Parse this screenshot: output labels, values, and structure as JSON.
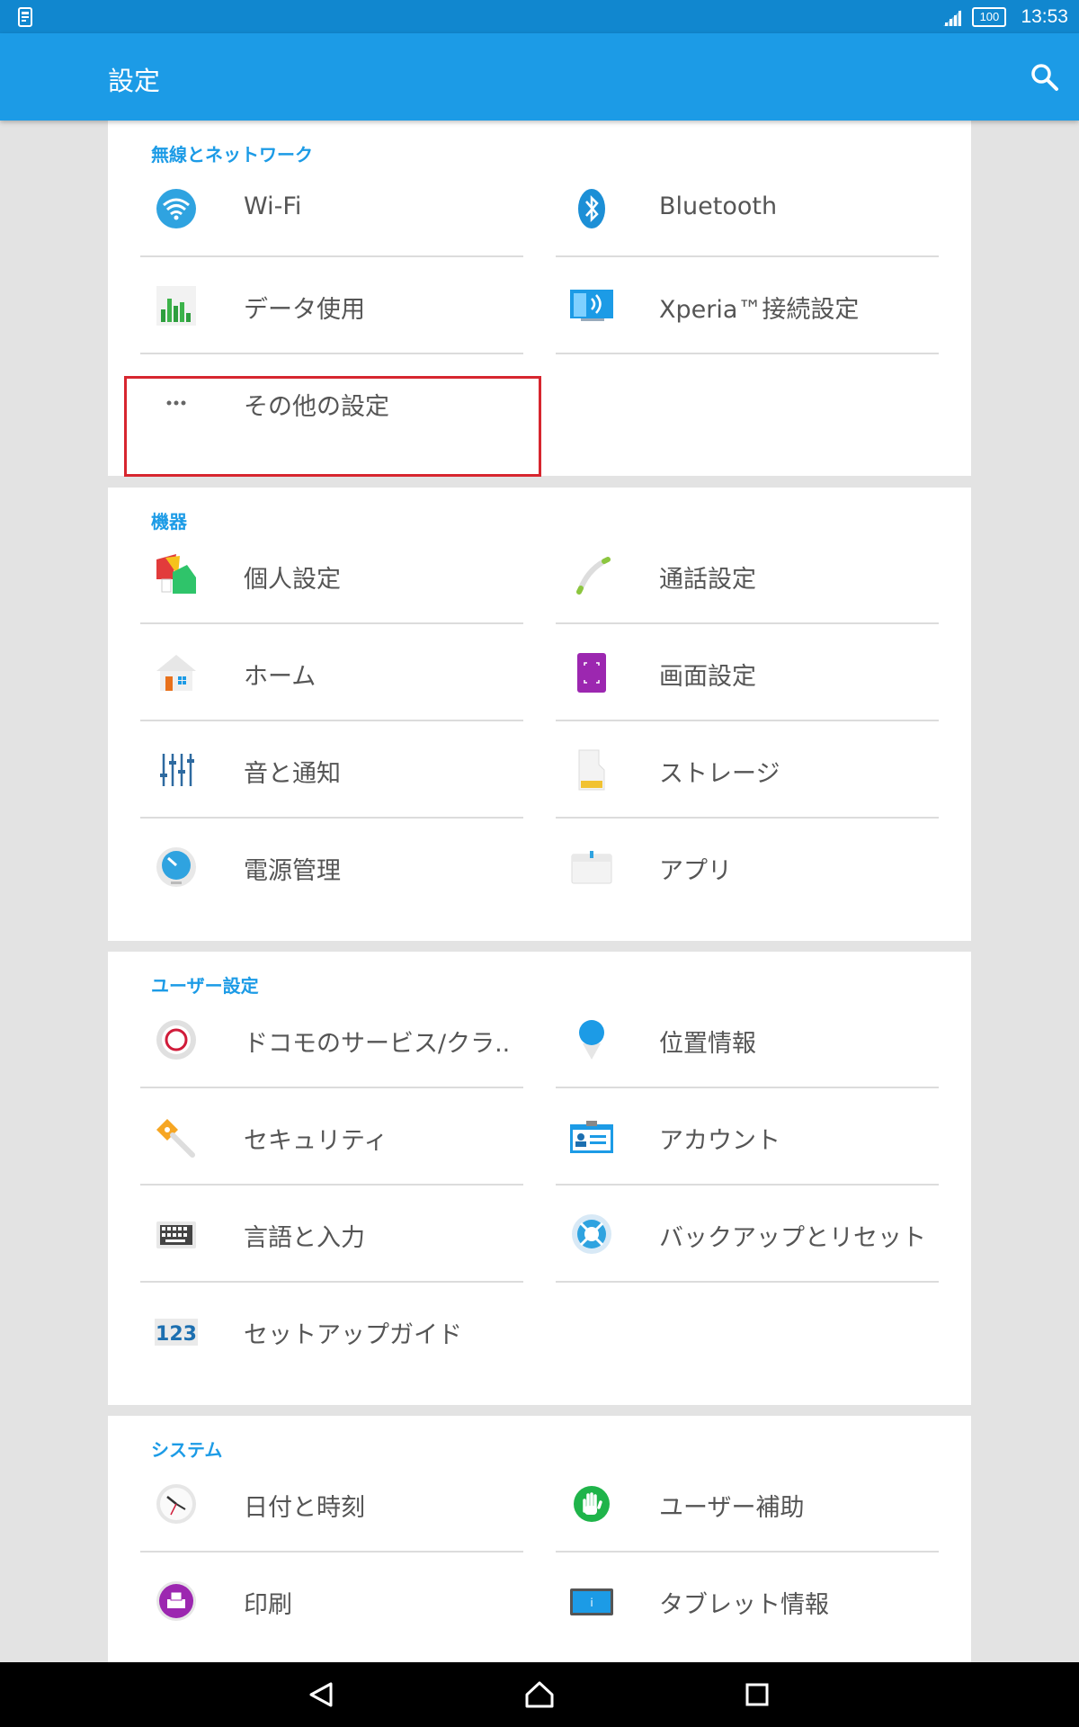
{
  "status_bar": {
    "time": "13:53",
    "battery": "100"
  },
  "app_bar": {
    "title": "設定"
  },
  "sections": {
    "wireless": {
      "title": "無線とネットワーク",
      "items": [
        "Wi-Fi",
        "Bluetooth",
        "データ使用",
        "Xperia™接続設定",
        "その他の設定"
      ]
    },
    "device": {
      "title": "機器",
      "items": [
        "個人設定",
        "通話設定",
        "ホーム",
        "画面設定",
        "音と通知",
        "ストレージ",
        "電源管理",
        "アプリ"
      ]
    },
    "user": {
      "title": "ユーザー設定",
      "items": [
        "ドコモのサービス/クラ..",
        "位置情報",
        "セキュリティ",
        "アカウント",
        "言語と入力",
        "バックアップとリセット",
        "セットアップガイド"
      ]
    },
    "system": {
      "title": "システム",
      "items": [
        "日付と時刻",
        "ユーザー補助",
        "印刷",
        "タブレット情報"
      ]
    }
  },
  "icons": {
    "wifi": "wifi-icon",
    "bluetooth": "bluetooth-icon",
    "data": "data-usage-icon",
    "xperia": "xperia-connect-icon",
    "more": "more-dots-icon"
  },
  "colors": {
    "accent": "#1c9be6",
    "status_bar": "#1187cf",
    "highlight": "#d7262f"
  }
}
